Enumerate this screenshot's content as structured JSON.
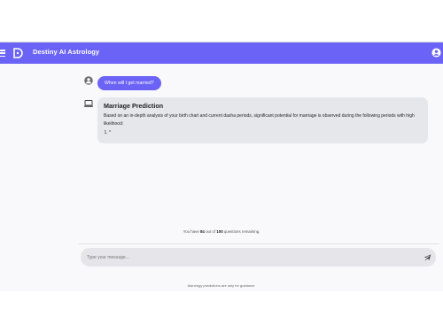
{
  "header": {
    "app_title": "Destiny AI Astrology",
    "accent_color": "#6b63f6",
    "menu_icon": "hamburger-menu-icon",
    "logo_icon": "destiny-logo-icon",
    "account_icon": "account-circle-icon"
  },
  "chat": {
    "user_message": "When will I get married?",
    "bot_title": "Marriage Prediction",
    "bot_text": "Based on an in-depth analysis of your birth chart and current dasha periods, significant potential for marriage is observed during the following periods with high likelihood:",
    "bot_list_items": [
      "*"
    ]
  },
  "quota": {
    "prefix": "You have ",
    "used": "84",
    "middle": " out of ",
    "total": "100",
    "suffix": " questions remaining."
  },
  "composer": {
    "placeholder": "Type your message...",
    "send_icon": "send-icon"
  },
  "footer": {
    "disclaimer": "Astrology predictions are only for guidance."
  }
}
